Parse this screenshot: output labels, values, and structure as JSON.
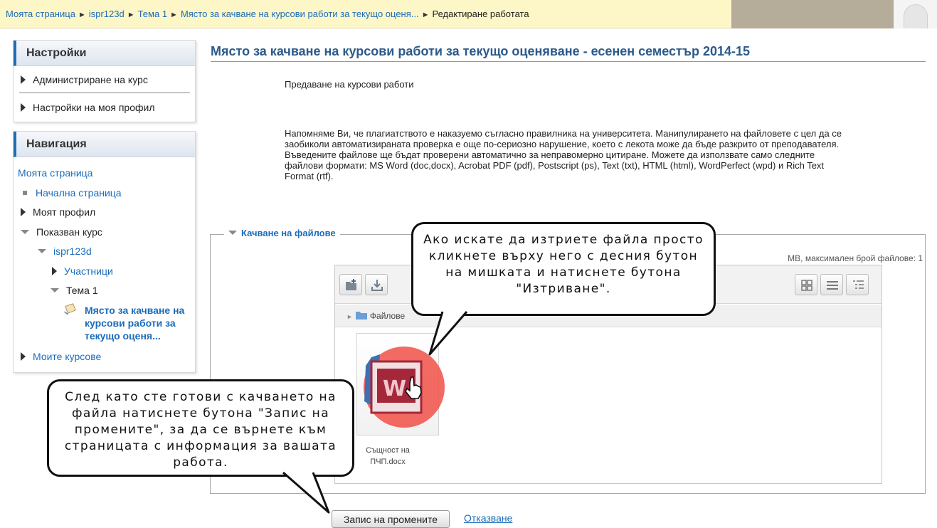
{
  "breadcrumb": {
    "items": [
      "Моята страница",
      "ispr123d",
      "Тема 1",
      "Място за качване на курсови работи за текущо оценя..."
    ],
    "current": "Редактиране работата",
    "separator": "►"
  },
  "settings": {
    "title": "Настройки",
    "items": [
      "Администриране на курс",
      "Настройки на моя профил"
    ]
  },
  "navigation": {
    "title": "Навигация",
    "my_page": "Моята страница",
    "home": "Начална страница",
    "my_profile": "Моят профил",
    "current_course": "Показван курс",
    "course": "ispr123d",
    "participants": "Участници",
    "topic": "Тема 1",
    "assignment": "Място за качване на курсови работи за текущо оценя...",
    "my_courses": "Моите курсове"
  },
  "main": {
    "title": "Място за качване на курсови работи за текущо оценяване - есенен семестър 2014-15",
    "intro": "Предаване на курсови работи",
    "plagiarism_notice": "Напомняме Ви, че плагиатството е наказуемо съгласно правилника на университета. Манипулирането на файловете с цел да се заобиколи автоматизираната проверка е още по-сериозно нарушение, което с лекота може да бъде разкрито от преподавателя. Въведените файлове ще бъдат проверени автоматично за неправомерно цитиране. Можете да използвате само следните файлови формати: MS Word (doc,docx), Acrobat PDF (pdf), Postscript (ps), Text (txt), HTML (html), WordPerfect (wpd) и Rich Text Format (rtf).",
    "upload_legend": "Качване на файлове",
    "limits": "MB, максимален брой файлове: 1",
    "path_label": "Файлове",
    "file": {
      "name_line1": "Същност на",
      "name_line2": "ПЧП.docx"
    }
  },
  "buttons": {
    "save": "Запис на промените",
    "cancel": "Отказване"
  },
  "callouts": {
    "delete": "Ако искате да изтриете файла просто кликнете върху него с десния бутон на мишката и натиснете бутона \"Изтриване\".",
    "save": "След като сте готови с качването на файла натиснете бутона \"Запис на промените\", за да се върнете към страницата с информация за вашата работа."
  },
  "icons": {
    "add_file": "add-file-icon",
    "download": "download-icon",
    "view_icons": "grid-view-icon",
    "view_list": "list-view-icon",
    "view_tree": "tree-view-icon",
    "folder": "folder-icon",
    "word_file": "word-document-icon",
    "cursor": "hand-cursor-icon"
  },
  "colors": {
    "link": "#1b6cbb",
    "title": "#2b5a8a",
    "breadcrumb_bg": "#fdf6c7",
    "block_accent": "#1f6fb5",
    "highlight": "#f05046",
    "word_brand": "#a4283a"
  }
}
